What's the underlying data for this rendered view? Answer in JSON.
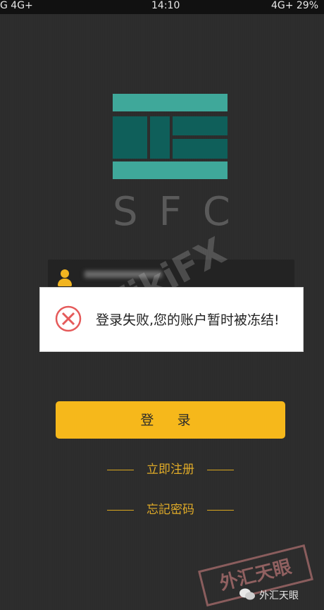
{
  "status_bar": {
    "left": "G 4G+ ",
    "time": "14:10",
    "right": "4G+ 29%"
  },
  "logo": {
    "text": "SFC"
  },
  "username": {
    "value": ""
  },
  "toast": {
    "message": "登录失败,您的账户暂时被冻结!",
    "icon": "error-circle-x-icon"
  },
  "actions": {
    "login_label": "登 录",
    "register_label": "立即注册",
    "forgot_label": "忘記密码"
  },
  "watermarks": {
    "stamp": "外汇天眼",
    "center": "WikiFX",
    "badge": "外汇天眼"
  },
  "colors": {
    "accent": "#f6b81b",
    "logo_light": "#3fa89a",
    "logo_dark": "#0f5f5a",
    "error": "#e55a5a"
  }
}
